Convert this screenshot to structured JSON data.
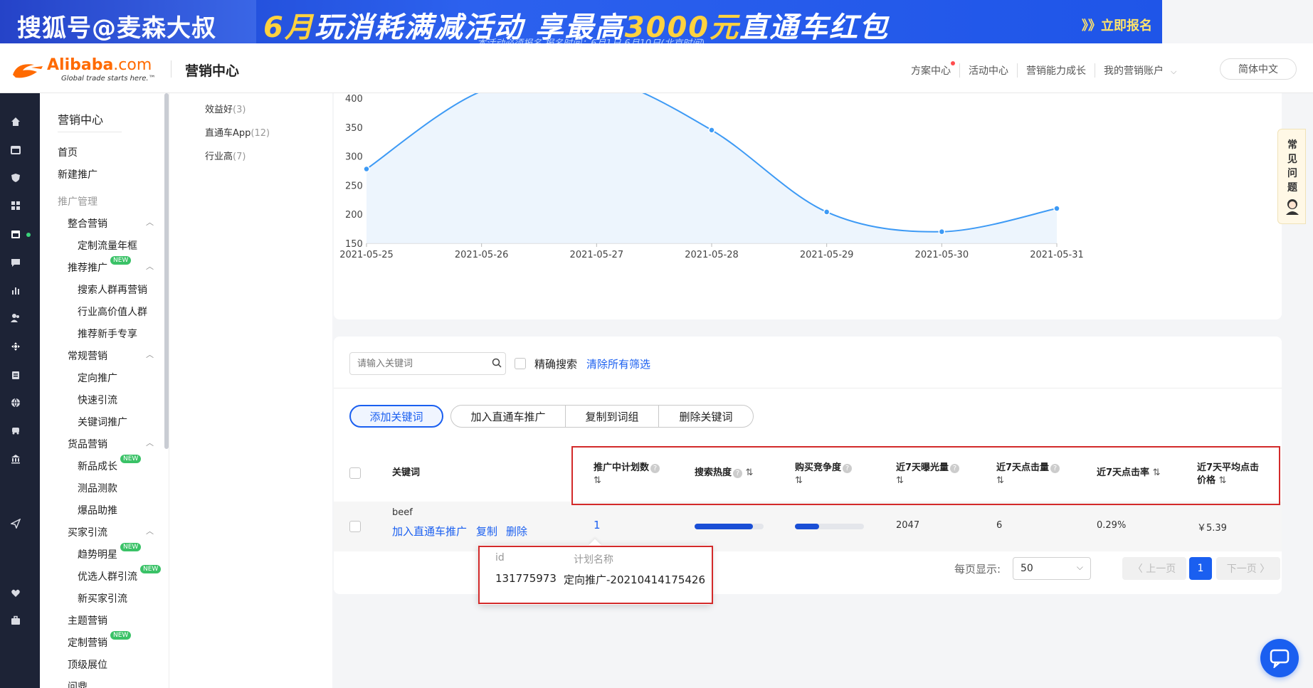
{
  "banner": {
    "sohu": "搜狐号@麦森大叔",
    "promo_prefix": "6月",
    "promo_main": "玩消耗满减活动  享最高",
    "promo_amount": "3000元",
    "promo_suffix": "直通车红包",
    "subtitle": "本活动必须报名  报名时间：6月1日-6月10日(北京时间)",
    "signup": "》》立即报名"
  },
  "header": {
    "logo_text": "Alibaba",
    "logo_com": ".com",
    "logo_tagline": "Global trade starts here.™",
    "title": "营销中心",
    "nav": [
      "方案中心",
      "活动中心",
      "营销能力成长",
      "我的营销账户"
    ],
    "language": "简体中文"
  },
  "sidebar": {
    "title": "营销中心",
    "items": [
      {
        "label": "首页"
      },
      {
        "label": "新建推广"
      },
      {
        "label": "推广管理"
      },
      {
        "label": "整合营销"
      },
      {
        "label": "定制流量年框"
      },
      {
        "label": "推荐推广",
        "badge": "NEW"
      },
      {
        "label": "搜索人群再营销"
      },
      {
        "label": "行业高价值人群"
      },
      {
        "label": "推荐新手专享"
      },
      {
        "label": "常规营销"
      },
      {
        "label": "定向推广"
      },
      {
        "label": "快速引流"
      },
      {
        "label": "关键词推广"
      },
      {
        "label": "货品营销"
      },
      {
        "label": "新品成长",
        "badge": "NEW"
      },
      {
        "label": "测品测款"
      },
      {
        "label": "爆品助推"
      },
      {
        "label": "买家引流"
      },
      {
        "label": "趋势明星",
        "badge": "NEW"
      },
      {
        "label": "优选人群引流",
        "badge": "NEW"
      },
      {
        "label": "新买家引流"
      },
      {
        "label": "主题营销"
      },
      {
        "label": "定制营销",
        "badge": "NEW"
      },
      {
        "label": "顶级展位"
      },
      {
        "label": "问鼎"
      }
    ]
  },
  "filters": [
    {
      "label": "效益好",
      "count": "(3)"
    },
    {
      "label": "直通车App",
      "count": "(12)"
    },
    {
      "label": "行业高",
      "count": "(7)"
    }
  ],
  "chart_data": {
    "type": "line",
    "x": [
      "2021-05-25",
      "2021-05-26",
      "2021-05-27",
      "2021-05-28",
      "2021-05-29",
      "2021-05-30",
      "2021-05-31"
    ],
    "y_ticks": [
      "150",
      "200",
      "250",
      "300",
      "350",
      "400"
    ],
    "ylim": [
      150,
      420
    ],
    "series": [
      {
        "values": [
          278,
          412,
          435,
          345,
          204,
          170,
          210
        ]
      }
    ],
    "color": "#3d9af5",
    "fill": "#e8f3fd",
    "grid": false
  },
  "help": {
    "label": "常见问题"
  },
  "keywords": {
    "search_placeholder": "请输入关键词",
    "exact_label": "精确搜索",
    "clear_label": "清除所有筛选",
    "buttons": {
      "add": "添加关键词",
      "join": "加入直通车推广",
      "copy_group": "复制到词组",
      "delete": "删除关键词"
    },
    "columns": {
      "keyword": "关键词",
      "plans": "推广中计划数",
      "heat": "搜索热度",
      "competition": "购买竞争度",
      "impressions": "近7天曝光量",
      "clicks": "近7天点击量",
      "ctr": "近7天点击率",
      "avg_price_1": "近7天平均点击",
      "avg_price_2": "价格",
      "sort": "⇅"
    },
    "row": {
      "keyword": "beef",
      "action_join": "加入直通车推广",
      "action_copy": "复制",
      "action_delete": "删除",
      "plans": "1",
      "heat": 0.85,
      "competition": 0.35,
      "impressions": "2047",
      "clicks": "6",
      "ctr": "0.29%",
      "avg_price": "￥5.39"
    },
    "popover": {
      "col_id": "id",
      "col_name": "计划名称",
      "id": "131775973",
      "name": "定向推广-20210414175426"
    },
    "pager": {
      "per_page_label": "每页显示:",
      "per_page": "50",
      "prev": "〈 上一页",
      "current": "1",
      "next": "下一页 〉"
    }
  }
}
